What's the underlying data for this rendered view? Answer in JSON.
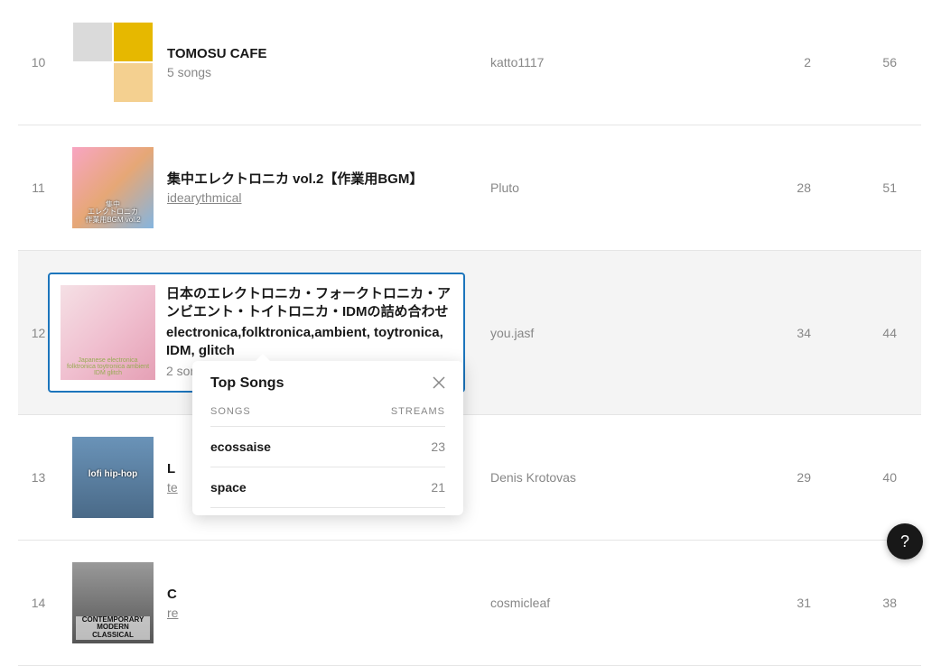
{
  "rows": [
    {
      "rank": "10",
      "title": "TOMOSU CAFE",
      "subtitle": "5 songs",
      "sublink": "",
      "listener": "katto1117",
      "col1": "2",
      "col2": "56"
    },
    {
      "rank": "11",
      "title": "集中エレクトロニカ vol.2【作業用BGM】",
      "subtitle": "",
      "sublink": "idearythmical",
      "art_label": "集中\nエレクトロニカ\n作業用BGM    vol.2",
      "listener": "Pluto",
      "col1": "28",
      "col2": "51"
    },
    {
      "rank": "12",
      "title": "日本のエレクトロニカ・フォークトロニカ・アンビエント・トイトロニカ・IDMの詰め合わせ",
      "tags": "electronica,folktronica,ambient, toytronica, IDM, glitch",
      "subtitle": "2 songs",
      "sublink": "",
      "art_label": "Japanese electronica folktronica toytronica ambient IDM glitch",
      "listener": "you.jasf",
      "col1": "34",
      "col2": "44",
      "selected": true
    },
    {
      "rank": "13",
      "title": "L",
      "subtitle": "",
      "sublink": "te",
      "art_label": "lofi hip-hop",
      "listener": "Denis Krotovas",
      "col1": "29",
      "col2": "40"
    },
    {
      "rank": "14",
      "title": "C",
      "subtitle": "",
      "sublink": "re",
      "art_label": "CONTEMPORARY MODERN CLASSICAL",
      "listener": "cosmicleaf",
      "col1": "31",
      "col2": "38"
    }
  ],
  "popover": {
    "title": "Top Songs",
    "col_songs": "SONGS",
    "col_streams": "STREAMS",
    "items": [
      {
        "song": "ecossaise",
        "streams": "23"
      },
      {
        "song": "space",
        "streams": "21"
      }
    ]
  },
  "help_label": "?"
}
